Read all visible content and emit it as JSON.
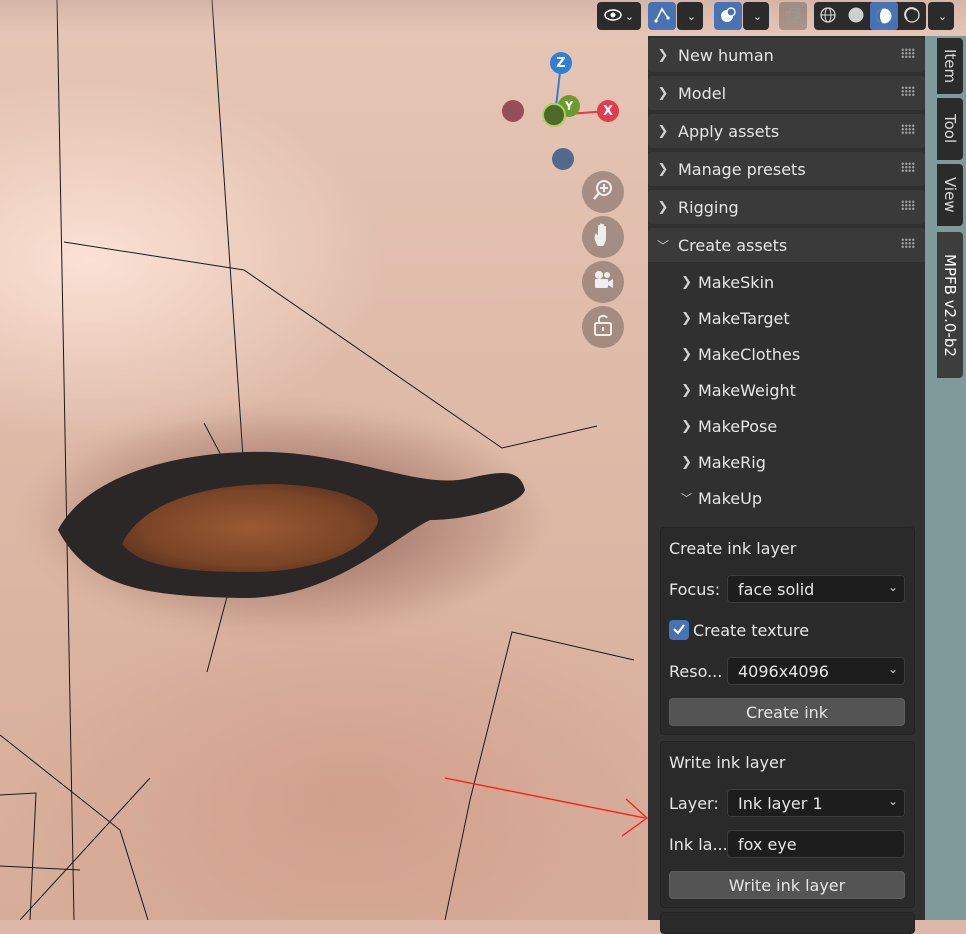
{
  "gizmo": {
    "z": "Z",
    "y": "Y",
    "x": "X"
  },
  "sidebar": {
    "panels": [
      {
        "label": "New human"
      },
      {
        "label": "Model"
      },
      {
        "label": "Apply assets"
      },
      {
        "label": "Manage presets"
      },
      {
        "label": "Rigging"
      },
      {
        "label": "Create assets"
      }
    ],
    "create_assets_items": [
      {
        "label": "MakeSkin"
      },
      {
        "label": "MakeTarget"
      },
      {
        "label": "MakeClothes"
      },
      {
        "label": "MakeWeight"
      },
      {
        "label": "MakePose"
      },
      {
        "label": "MakeRig"
      },
      {
        "label": "MakeUp"
      }
    ],
    "create_ink": {
      "title": "Create ink layer",
      "focus_label": "Focus:",
      "focus_value": "face solid",
      "create_texture_label": "Create texture",
      "create_texture_checked": true,
      "resolution_label": "Reso...",
      "resolution_value": "4096x4096",
      "button": "Create ink"
    },
    "write_ink": {
      "title": "Write ink layer",
      "layer_label": "Layer:",
      "layer_value": "Ink layer 1",
      "ink_label": "Ink la...",
      "ink_value": "fox eye",
      "button": "Write ink layer"
    }
  },
  "tabs": [
    {
      "label": "Item",
      "active": false
    },
    {
      "label": "Tool",
      "active": false
    },
    {
      "label": "View",
      "active": false
    },
    {
      "label": "MPFB v2.0-b2",
      "active": true
    }
  ],
  "colors": {
    "accent": "#4772b3",
    "axis_x": "#e23a4f",
    "axis_y": "#6b9b2f",
    "axis_z": "#2f7fd6",
    "annotation_arrow": "#ff1a1a"
  }
}
